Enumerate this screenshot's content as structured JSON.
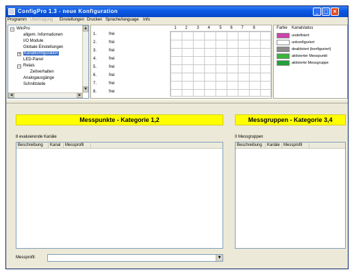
{
  "window": {
    "title": "ConfigPro 1.3 - neue Konfiguration"
  },
  "menu": {
    "items": [
      "Programm",
      "Übertragung",
      "Einstellungen",
      "Drucken",
      "Sprache/language",
      "Info"
    ],
    "disabled_item": "Übertragung"
  },
  "tree": {
    "items": [
      "WinPro",
      "allgem. Informationen",
      "I/O Module",
      "Globale Einstellungen",
      "Kanalkonfiguration",
      "LED-Panel",
      "Relais",
      "Zeitverhalten",
      "Analogausgänge",
      "Schnittstelle"
    ],
    "selected": "Kanalkonfiguration"
  },
  "channels": {
    "numbers": [
      "1.",
      "2.",
      "3.",
      "4.",
      "5.",
      "6.",
      "7.",
      "8."
    ],
    "labels": [
      "frei",
      "frei",
      "frei",
      "frei",
      "frei",
      "frei",
      "frei",
      "frei"
    ],
    "columns": [
      "1",
      "2",
      "3",
      "4",
      "5",
      "6",
      "7",
      "8"
    ]
  },
  "legend": {
    "header_color": "Farbe",
    "header_status": "Kanalstatus",
    "items": [
      {
        "label": "undefiniert",
        "color": "#cc44aa"
      },
      {
        "label": "unkonfiguriert",
        "color": "#ffffff"
      },
      {
        "label": "deaktiviert (konfiguriert)",
        "color": "#8c8c8c"
      },
      {
        "label": "aktivierter Messpunkt",
        "color": "#3cb43c"
      },
      {
        "label": "aktivierte Messgruppe",
        "color": "#22a03a"
      }
    ]
  },
  "left_panel": {
    "banner": "Messpunkte - Kategorie 1,2",
    "subtitle": "8 evaluierende Kanäle",
    "columns": [
      "Beschreibung",
      "Kanal",
      "Messprofil"
    ]
  },
  "right_panel": {
    "banner": "Messgruppen - Kategorie 3,4",
    "subtitle": "0 Messgruppen",
    "columns": [
      "Beschreibung",
      "Kanäle",
      "Messprofil"
    ]
  },
  "profile": {
    "label": "Messprofil:",
    "value": ""
  },
  "colors": {
    "banner": "#ffff00",
    "titlebar": "#0a5ae6",
    "selection": "#316ac5"
  }
}
